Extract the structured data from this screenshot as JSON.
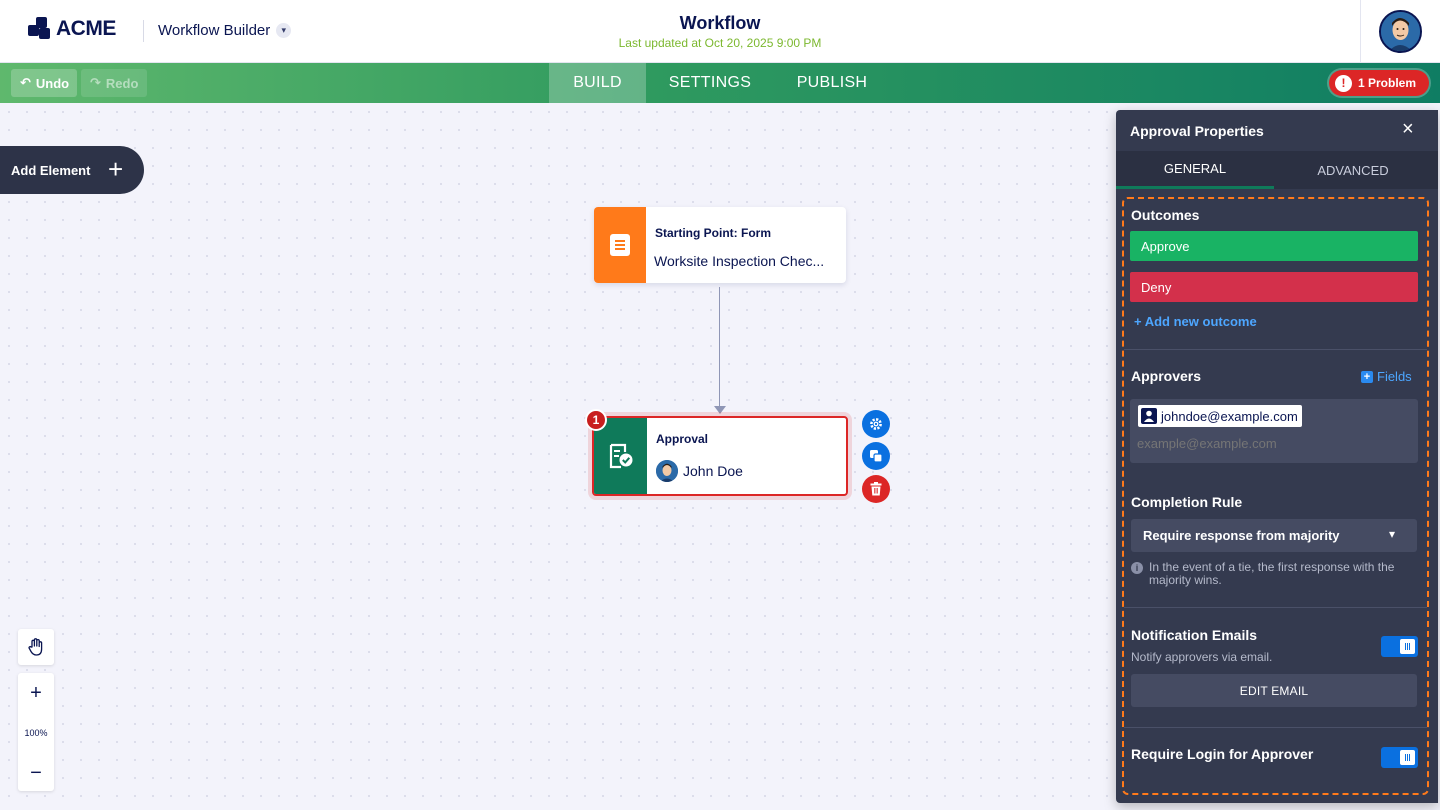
{
  "header": {
    "brand": "ACME",
    "app_switcher": "Workflow Builder",
    "title": "Workflow",
    "updated": "Last updated at Oct 20, 2025 9:00 PM"
  },
  "toolbar": {
    "undo": "Undo",
    "redo": "Redo",
    "tabs": [
      "BUILD",
      "SETTINGS",
      "PUBLISH"
    ],
    "active_tab": "BUILD",
    "problem": "1 Problem"
  },
  "canvas": {
    "add_element": "Add Element",
    "start_node": {
      "title": "Starting Point: Form",
      "subtitle": "Worksite Inspection Chec..."
    },
    "approval_node": {
      "title": "Approval",
      "approver": "John Doe",
      "badge": "1"
    },
    "zoom": "100%"
  },
  "panel": {
    "title": "Approval Properties",
    "tabs": [
      "GENERAL",
      "ADVANCED"
    ],
    "outcomes_label": "Outcomes",
    "outcomes": [
      "Approve",
      "Deny"
    ],
    "add_outcome": "+ Add new outcome",
    "approvers_label": "Approvers",
    "fields_link": "Fields",
    "approver_chip": "johndoe@example.com",
    "approver_placeholder": "example@example.com",
    "completion_label": "Completion Rule",
    "completion_value": "Require response from majority",
    "completion_hint": "In the event of a tie, the first response with the majority wins.",
    "notification_label": "Notification Emails",
    "notification_sub": "Notify approvers via email.",
    "edit_email": "EDIT EMAIL",
    "require_login_label": "Require Login for Approver"
  },
  "colors": {
    "approve": "#19b364",
    "deny": "#d3304b",
    "toggle_on": "#0a70e0",
    "problem": "#dc2626",
    "highlight": "#ff7a1a"
  }
}
